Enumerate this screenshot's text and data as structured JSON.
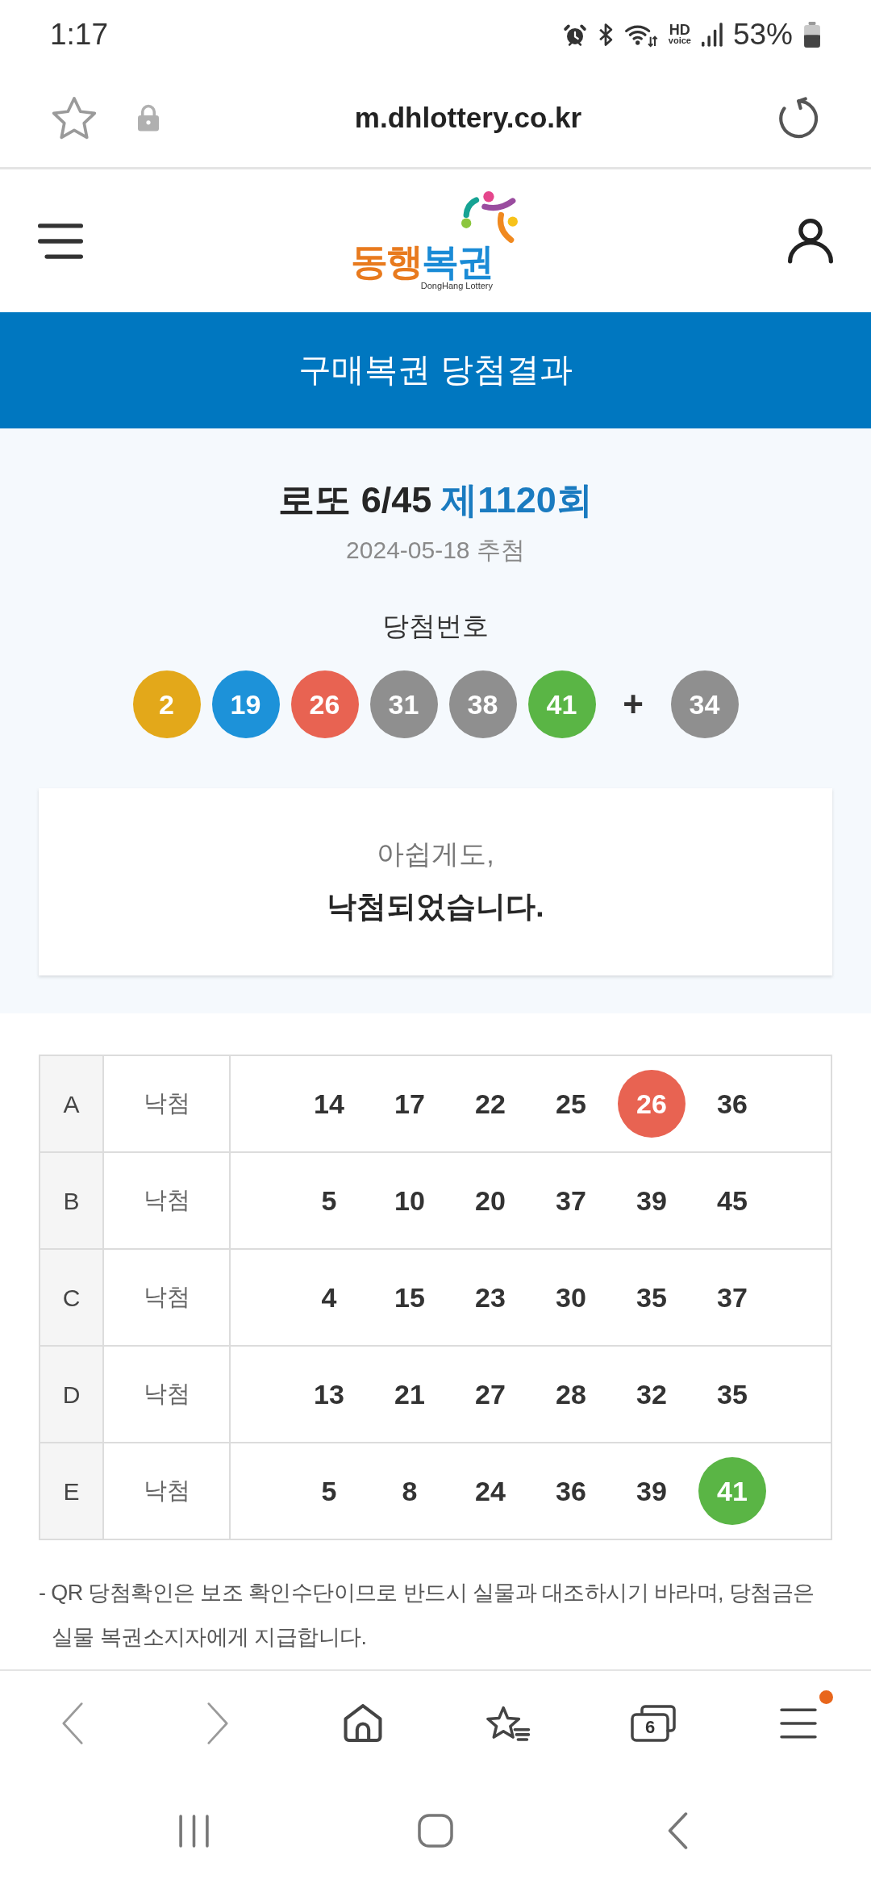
{
  "status_bar": {
    "time": "1:17",
    "network_label": {
      "top": "HD",
      "bottom": "voice"
    },
    "battery_text": "53%"
  },
  "address_bar": {
    "url": "m.dhlottery.co.kr"
  },
  "header": {
    "logo": {
      "title": [
        {
          "text": "동행",
          "color": "#e87a1e"
        },
        {
          "text": "복권",
          "color": "#1a8bd6"
        }
      ],
      "subtitle": "DongHang Lottery"
    }
  },
  "page_title": "구매복권 당첨결과",
  "draw": {
    "game": "로또 6/45",
    "round": "제1120회",
    "date": "2024-05-18 추첨",
    "numbers_label": "당첨번호",
    "balls": [
      {
        "number": "2",
        "color": "#e3a81a"
      },
      {
        "number": "19",
        "color": "#1d92d9"
      },
      {
        "number": "26",
        "color": "#e86352"
      },
      {
        "number": "31",
        "color": "#8f8f8f"
      },
      {
        "number": "38",
        "color": "#8f8f8f"
      },
      {
        "number": "41",
        "color": "#5ab545"
      }
    ],
    "plus": "+",
    "bonus": {
      "number": "34",
      "color": "#8f8f8f"
    }
  },
  "result": {
    "line_1": "아쉽게도,",
    "line_2": "낙첨되었습니다."
  },
  "tickets": [
    {
      "line": "A",
      "result": "낙첨",
      "numbers": [
        {
          "value": "14",
          "matched": false
        },
        {
          "value": "17",
          "matched": false
        },
        {
          "value": "22",
          "matched": false
        },
        {
          "value": "25",
          "matched": false
        },
        {
          "value": "26",
          "matched": true,
          "color": "#e86352"
        },
        {
          "value": "36",
          "matched": false
        }
      ]
    },
    {
      "line": "B",
      "result": "낙첨",
      "numbers": [
        {
          "value": "5",
          "matched": false
        },
        {
          "value": "10",
          "matched": false
        },
        {
          "value": "20",
          "matched": false
        },
        {
          "value": "37",
          "matched": false
        },
        {
          "value": "39",
          "matched": false
        },
        {
          "value": "45",
          "matched": false
        }
      ]
    },
    {
      "line": "C",
      "result": "낙첨",
      "numbers": [
        {
          "value": "4",
          "matched": false
        },
        {
          "value": "15",
          "matched": false
        },
        {
          "value": "23",
          "matched": false
        },
        {
          "value": "30",
          "matched": false
        },
        {
          "value": "35",
          "matched": false
        },
        {
          "value": "37",
          "matched": false
        }
      ]
    },
    {
      "line": "D",
      "result": "낙첨",
      "numbers": [
        {
          "value": "13",
          "matched": false
        },
        {
          "value": "21",
          "matched": false
        },
        {
          "value": "27",
          "matched": false
        },
        {
          "value": "28",
          "matched": false
        },
        {
          "value": "32",
          "matched": false
        },
        {
          "value": "35",
          "matched": false
        }
      ]
    },
    {
      "line": "E",
      "result": "낙첨",
      "numbers": [
        {
          "value": "5",
          "matched": false
        },
        {
          "value": "8",
          "matched": false
        },
        {
          "value": "24",
          "matched": false
        },
        {
          "value": "36",
          "matched": false
        },
        {
          "value": "39",
          "matched": false
        },
        {
          "value": "41",
          "matched": true,
          "color": "#5ab545"
        }
      ]
    }
  ],
  "notice": "- QR 당첨확인은 보조 확인수단이므로 반드시 실물과 대조하시기 바라며, 당첨금은 실물 복권소지자에게 지급합니다.",
  "browser_nav": {
    "tab_count": "6",
    "menu_badge": true
  }
}
